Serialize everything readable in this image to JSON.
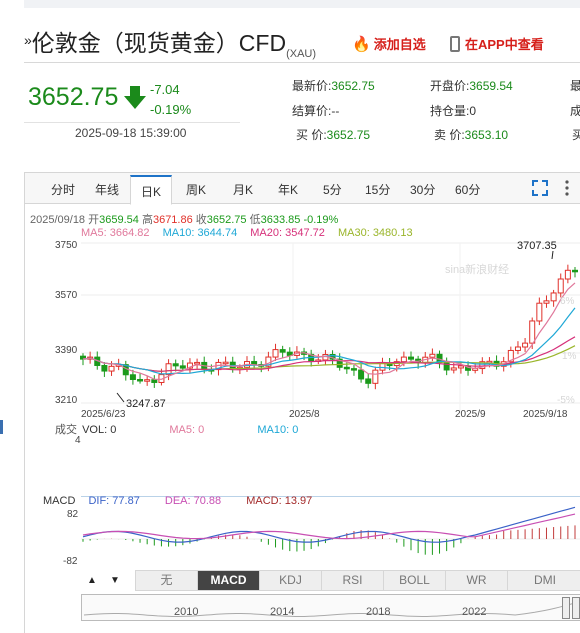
{
  "header": {
    "title": "伦敦金（现货黄金）CFD",
    "title_mark": "»",
    "title_sub": "(XAU)",
    "add_favorite": "添加自选",
    "app_view": "在APP中查看"
  },
  "quote": {
    "price": "3652.75",
    "change": "-7.04",
    "change_pct": "-0.19%",
    "time": "2025-09-18 15:39:00",
    "direction": "down"
  },
  "stats": [
    {
      "label": "最新价:",
      "value": "3652.75"
    },
    {
      "label": "结算价:",
      "value": "--"
    },
    {
      "label": "买  价:",
      "value": "3652.75"
    },
    {
      "label": "开盘价:",
      "value": "3659.54"
    },
    {
      "label": "持仓量:",
      "value": "0"
    },
    {
      "label": "卖  价:",
      "value": "3653.10"
    }
  ],
  "stats_cut": [
    "最",
    "成",
    "买"
  ],
  "tabs": [
    "分时",
    "年线",
    "日K",
    "周K",
    "月K",
    "年K",
    "5分",
    "15分",
    "30分",
    "60分"
  ],
  "active_tab": "日K",
  "icons": {
    "fullscreen": "fullscreen-icon",
    "more": "more-icon",
    "up": "up-arrow-icon",
    "down": "down-arrow-icon"
  },
  "info_line": {
    "date": "2025/09/18",
    "open_label": "开",
    "open": "3659.54",
    "high_label": "高",
    "high": "3671.86",
    "close_label": "收",
    "close": "3652.75",
    "low_label": "低",
    "low": "3633.85",
    "pct": "-0.19%"
  },
  "ma_line": [
    {
      "label": "MA5:",
      "value": "3664.82",
      "color": "#e0789b"
    },
    {
      "label": "MA10:",
      "value": "3644.74",
      "color": "#1fa8d6"
    },
    {
      "label": "MA20:",
      "value": "3547.72",
      "color": "#d6307a"
    },
    {
      "label": "MA30:",
      "value": "3480.13",
      "color": "#9ab52a"
    }
  ],
  "price_axis": [
    "3750",
    "3570",
    "3390",
    "3210"
  ],
  "pct_axis": [
    "6%",
    "1%",
    "-5%"
  ],
  "annotations": {
    "max": "3707.35",
    "min": "3247.87",
    "watermark": "sina新浪财经"
  },
  "date_axis": [
    "2025/6/23",
    "2025/8",
    "2025/9",
    "2025/9/18"
  ],
  "volume": {
    "title": "成交",
    "vol_label": "VOL:",
    "vol": "0",
    "ma5_label": "MA5:",
    "ma5": "0",
    "ma10_label": "MA10:",
    "ma10": "0",
    "axis": "4"
  },
  "macd": {
    "title": "MACD",
    "dif_label": "DIF:",
    "dif": "77.87",
    "dea_label": "DEA:",
    "dea": "70.88",
    "macd_label": "MACD:",
    "macd": "13.97",
    "axis_top": "82",
    "axis_bottom": "-82"
  },
  "indicator_tabs": [
    "无",
    "MACD",
    "KDJ",
    "RSI",
    "BOLL",
    "WR",
    "DMI"
  ],
  "active_indicator": "MACD",
  "range_years": [
    "2010",
    "2014",
    "2018",
    "2022"
  ],
  "colors": {
    "up": "#e0312a",
    "down": "#1b9a1b",
    "accent": "#1e73c8",
    "red": "#d6201b"
  }
}
